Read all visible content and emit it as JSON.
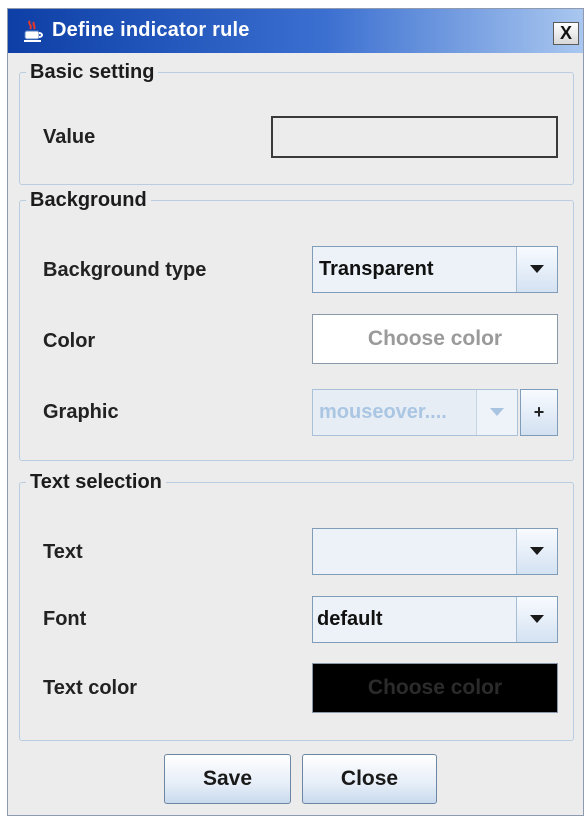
{
  "window": {
    "title": "Define indicator rule",
    "close_label": "X",
    "icon": "java-cup-icon"
  },
  "basic_setting": {
    "legend": "Basic setting",
    "value_label": "Value",
    "value_input": ""
  },
  "background": {
    "legend": "Background",
    "type_label": "Background type",
    "type_selected": "Transparent",
    "color_label": "Color",
    "color_button": "Choose color",
    "graphic_label": "Graphic",
    "graphic_selected": "mouseover....",
    "graphic_add": "+"
  },
  "text_selection": {
    "legend": "Text selection",
    "text_label": "Text",
    "text_selected": "",
    "font_label": "Font",
    "font_selected": "default",
    "text_color_label": "Text color",
    "text_color_button": "Choose color"
  },
  "footer": {
    "save": "Save",
    "close": "Close"
  }
}
